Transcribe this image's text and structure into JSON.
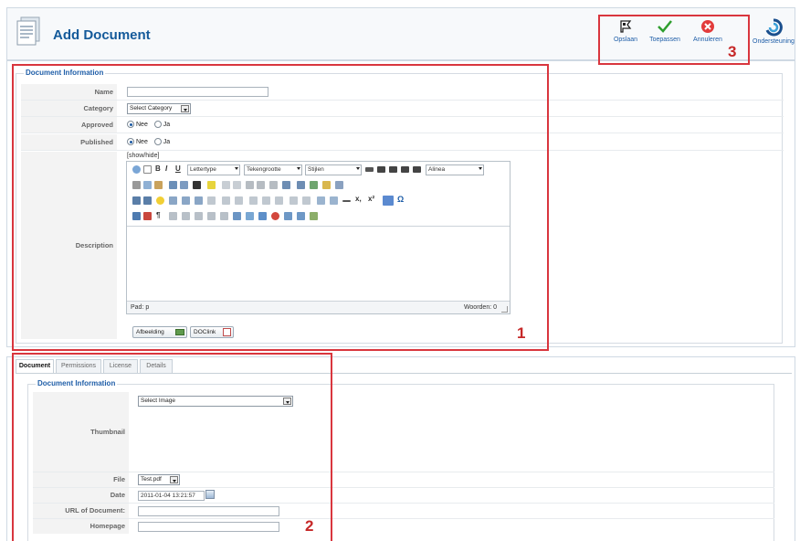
{
  "header": {
    "title": "Add Document",
    "toolbar": [
      {
        "label": "Opslaan",
        "icon": "save-icon"
      },
      {
        "label": "Toepassen",
        "icon": "apply-check-icon"
      },
      {
        "label": "Annuleren",
        "icon": "cancel-icon"
      },
      {
        "label": "Ondersteuning",
        "icon": "support-icon"
      }
    ]
  },
  "section1": {
    "legend": "Document Information",
    "fields": {
      "name": {
        "label": "Name",
        "value": ""
      },
      "category": {
        "label": "Category",
        "value": "Select Category"
      },
      "approved": {
        "label": "Approved",
        "options": [
          "Nee",
          "Ja"
        ],
        "selected": "Nee"
      },
      "published": {
        "label": "Published",
        "options": [
          "Nee",
          "Ja"
        ],
        "selected": "Nee"
      },
      "description": {
        "label": "Description"
      }
    },
    "editor": {
      "toggle": "[show/hide]",
      "font_family": "Lettertype",
      "font_size": "Tekengrootte",
      "styles": "Stijlen",
      "format": "Alinea",
      "path": "Pad: p",
      "wordcount": "Woorden: 0",
      "buttons": [
        "Afbeelding",
        "DOClink"
      ]
    }
  },
  "tabs": {
    "items": [
      "Document",
      "Permissions",
      "License",
      "Details"
    ],
    "active": "Document"
  },
  "section2": {
    "legend": "Document Information",
    "fields": {
      "thumbnail": {
        "label": "Thumbnail",
        "value": "Select Image"
      },
      "file": {
        "label": "File",
        "value": "Test.pdf"
      },
      "date": {
        "label": "Date",
        "value": "2011-01-04 13:21:57"
      },
      "url": {
        "label": "URL of Document:",
        "value": ""
      },
      "homepage": {
        "label": "Homepage",
        "value": ""
      }
    }
  },
  "annotations": [
    "1",
    "2",
    "3"
  ],
  "colors": {
    "accent": "#1f5ea8",
    "highlight": "#d9363e"
  }
}
